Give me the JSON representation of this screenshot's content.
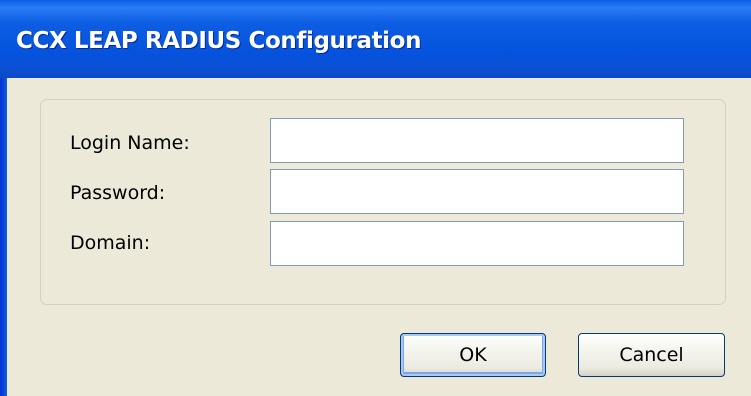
{
  "window": {
    "title": "CCX LEAP RADIUS Configuration"
  },
  "form": {
    "login_name": {
      "label": "Login Name:",
      "value": ""
    },
    "password": {
      "label": "Password:",
      "value": ""
    },
    "domain": {
      "label": "Domain:",
      "value": ""
    }
  },
  "buttons": {
    "ok_label": "OK",
    "cancel_label": "Cancel"
  },
  "colors": {
    "titlebar_blue": "#0553de",
    "dialog_background": "#ece9d8",
    "input_border": "#7f9db9",
    "button_border": "#003c74"
  }
}
